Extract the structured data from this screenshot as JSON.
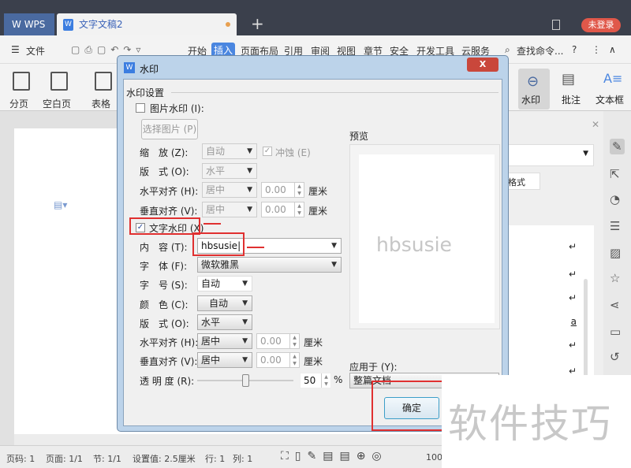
{
  "titlebar": {
    "home_tab": "WPS",
    "doc_tab": "文字文稿2",
    "new_tab": "+",
    "login": "未登录"
  },
  "menu": {
    "file": "文件",
    "tabs": [
      "开始",
      "插入",
      "页面布局",
      "引用",
      "审阅",
      "视图",
      "章节",
      "安全",
      "开发工具",
      "云服务"
    ],
    "active_tab": "插入",
    "search": "查找命令...",
    "help": "?"
  },
  "ribbon": {
    "items": [
      "分页",
      "空白页",
      "表格",
      "水印",
      "批注",
      "文本框"
    ]
  },
  "right_pane": {
    "format_btn": "格式"
  },
  "status": {
    "page_num": "页码: 1",
    "pages": "页面: 1/1",
    "section": "节: 1/1",
    "setting": "设置值: 2.5厘米",
    "row": "行: 1",
    "col": "列: 1",
    "zoom": "100%"
  },
  "dialog": {
    "title": "水印",
    "close": "X",
    "group": "水印设置",
    "picture": {
      "label": "图片水印 (I):",
      "checked": false,
      "choose_btn": "选择图片 (P)",
      "scale_label": "缩　放 (Z):",
      "scale": "自动",
      "washout_label": "冲蚀 (E)",
      "washout": true,
      "layout_label": "版　式 (O):",
      "layout": "水平",
      "h_align_label": "水平对齐 (H):",
      "h_align": "居中",
      "h_offset": "0.00",
      "v_align_label": "垂直对齐 (V):",
      "v_align": "居中",
      "v_offset": "0.00",
      "unit": "厘米"
    },
    "text": {
      "label": "文字水印 (X)",
      "checked": true,
      "content_label": "内　容 (T):",
      "content": "hbsusie",
      "font_label": "字　体 (F):",
      "font": "微软雅黑",
      "size_label": "字　号 (S):",
      "size": "自动",
      "color_label": "颜　色 (C):",
      "color": "自动",
      "layout_label": "版　式 (O):",
      "layout": "水平",
      "h_align_label": "水平对齐 (H):",
      "h_align": "居中",
      "h_offset": "0.00",
      "v_align_label": "垂直对齐 (V):",
      "v_align": "居中",
      "v_offset": "0.00",
      "unit": "厘米",
      "transparency_label": "透 明 度 (R):",
      "transparency": 50,
      "percent": "%"
    },
    "preview_label": "预览",
    "preview_text": "hbsusie",
    "apply_label": "应用于 (Y):",
    "apply": "整篇文档",
    "ok": "确定"
  },
  "watermark_overlay": "软件技巧",
  "colors": {
    "accent": "#4a86e0",
    "annotation_red": "#e03030",
    "login": "#e0584a"
  }
}
